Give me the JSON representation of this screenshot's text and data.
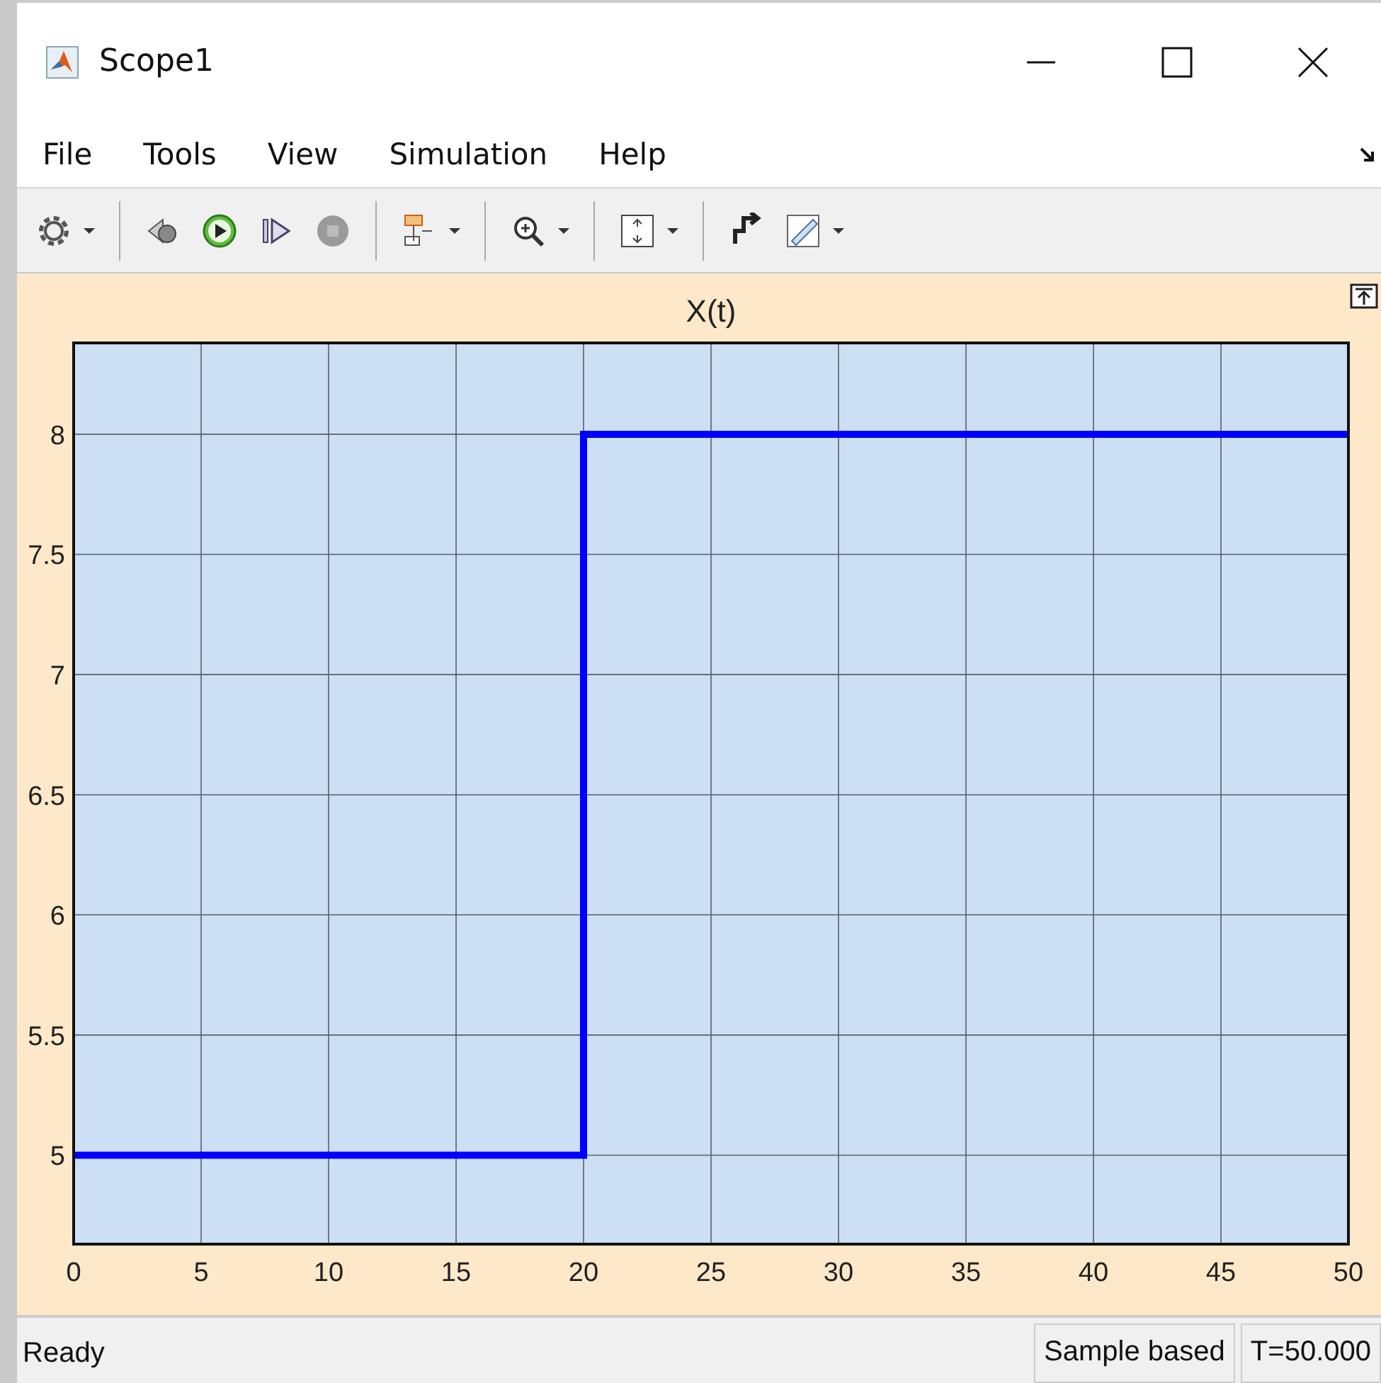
{
  "window": {
    "title": "Scope1"
  },
  "menu": [
    {
      "label": "File"
    },
    {
      "label": "Tools"
    },
    {
      "label": "View"
    },
    {
      "label": "Simulation"
    },
    {
      "label": "Help"
    }
  ],
  "plot": {
    "chart_data": {
      "type": "line",
      "title": "X(t)",
      "x": [
        0,
        20,
        20,
        50
      ],
      "series": [
        {
          "color": "#0000ff",
          "values": [
            5,
            5,
            8,
            8
          ]
        }
      ],
      "grid": true,
      "xlim": [
        0,
        50
      ],
      "ylim": [
        4.63,
        8.38
      ],
      "xticks": [
        0,
        5,
        10,
        15,
        20,
        25,
        30,
        35,
        40,
        45,
        50
      ],
      "yticks": [
        5,
        5.5,
        6,
        6.5,
        7,
        7.5,
        8
      ]
    }
  },
  "status_bar": {
    "message": "Ready",
    "fields": [
      "Sample based",
      "T=50.000"
    ]
  }
}
